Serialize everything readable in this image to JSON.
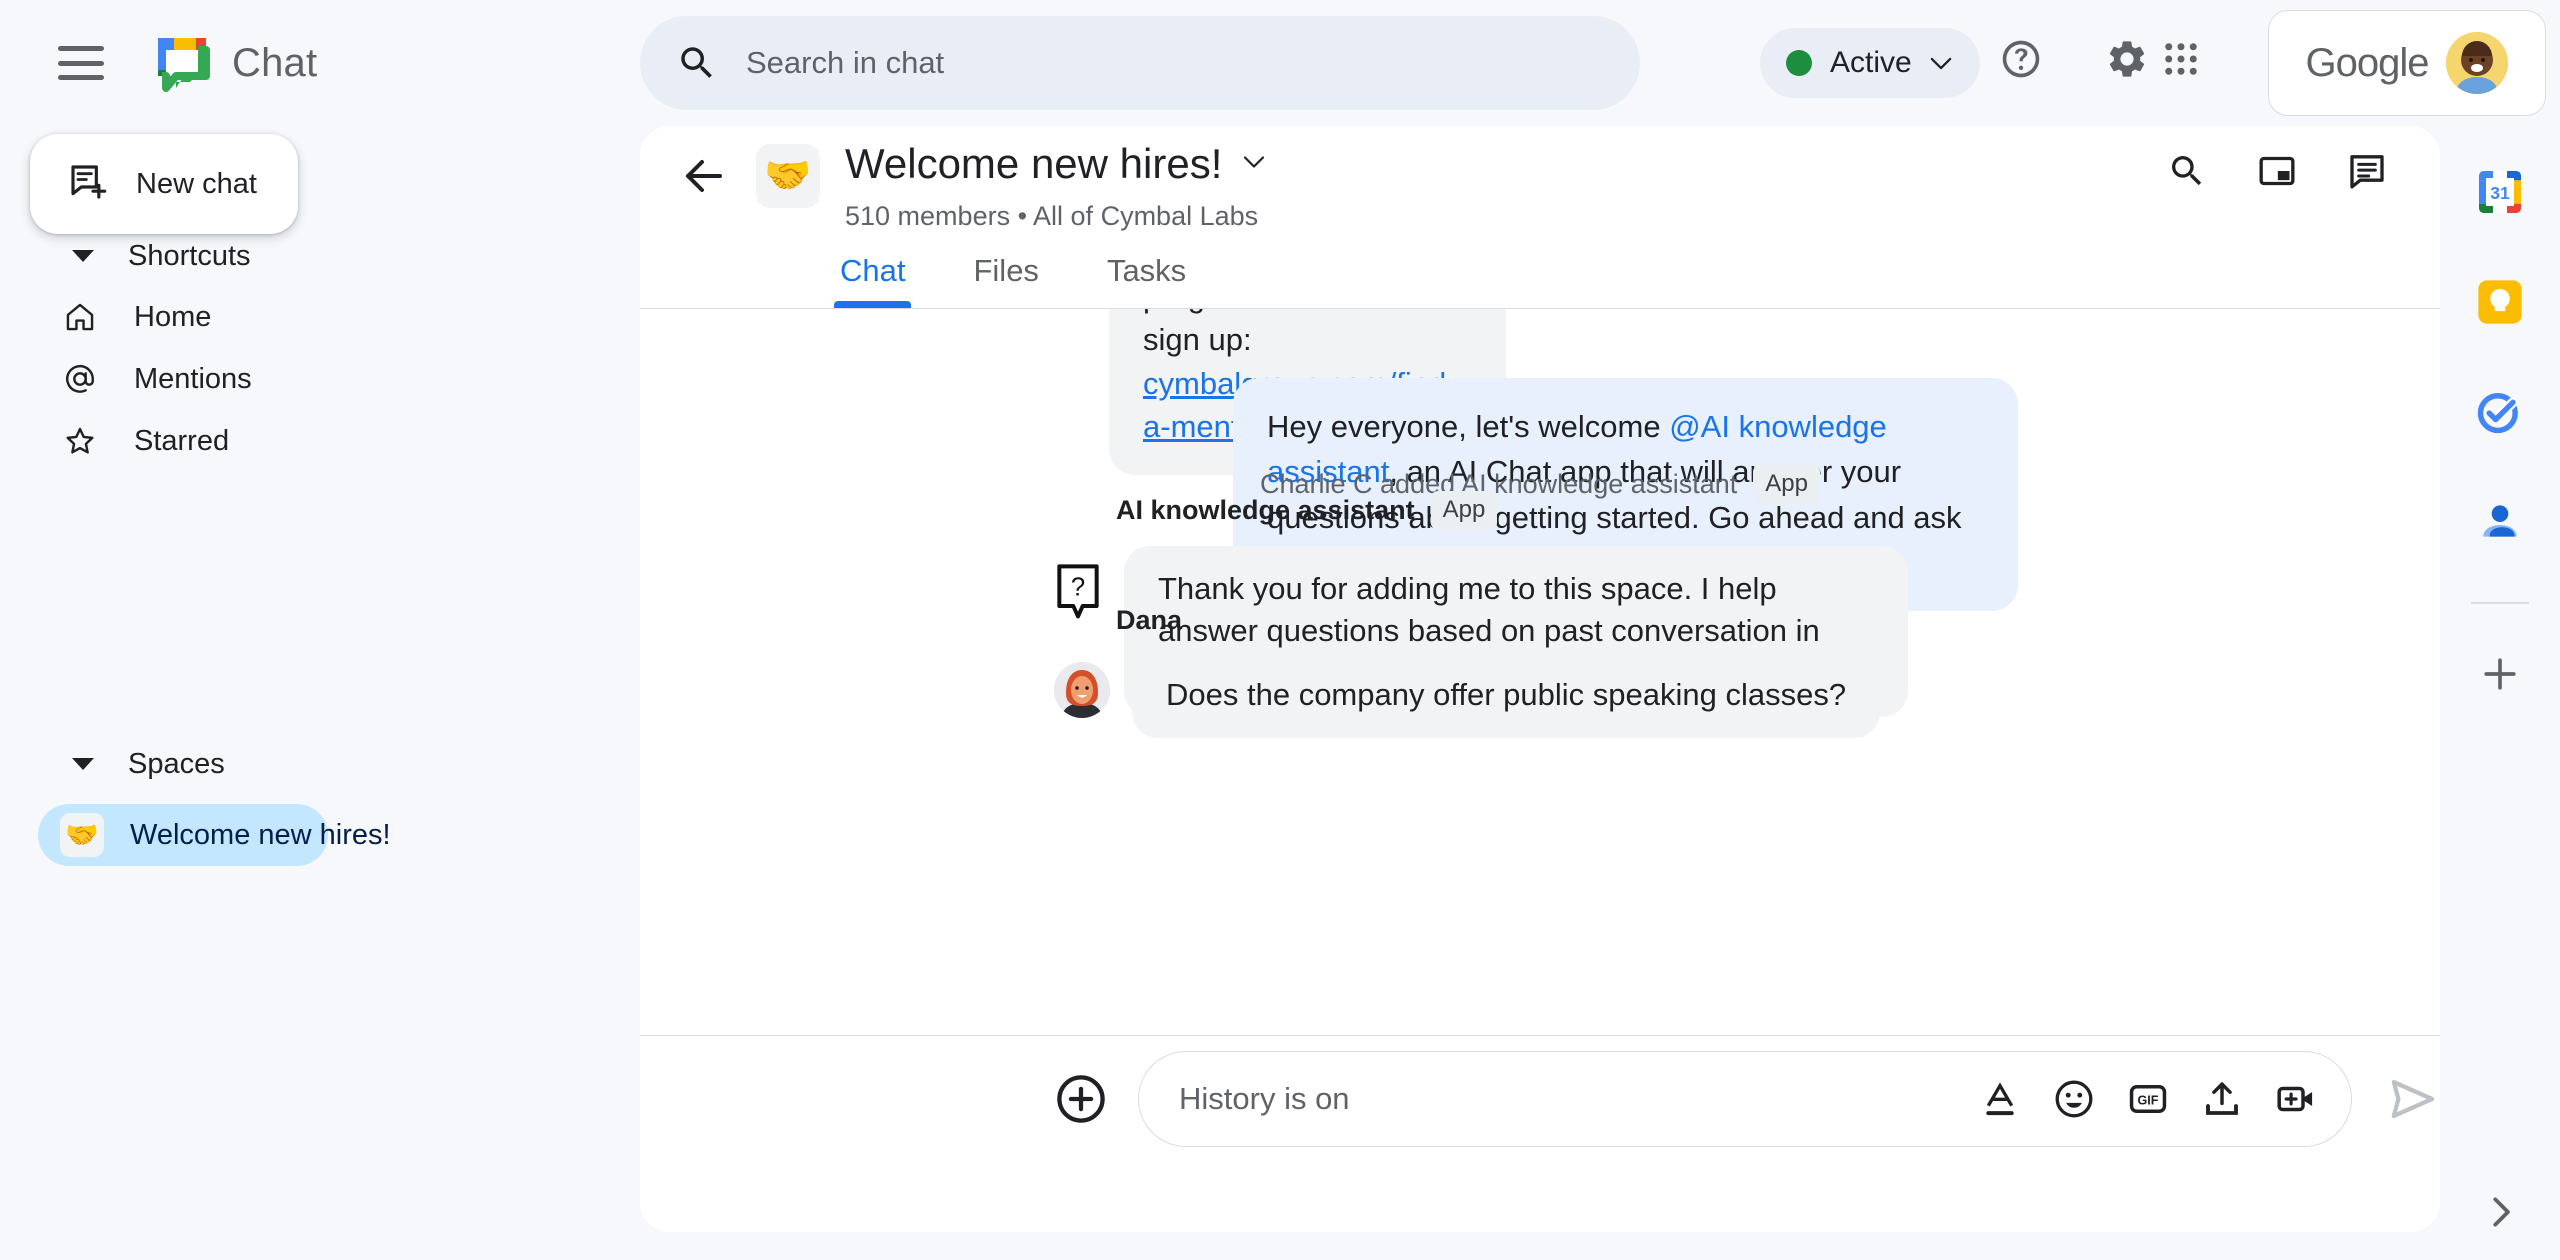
{
  "topbar": {
    "menu_icon": "hamburger-icon",
    "brand": "Chat",
    "brand_logo_icon": "google-chat-logo",
    "search": {
      "placeholder": "Search in chat",
      "icon": "search-icon"
    },
    "status": {
      "label": "Active",
      "color": "#1e8e3e",
      "chevron_icon": "chevron-down-icon"
    },
    "help_icon": "help-icon",
    "settings_icon": "gear-icon",
    "apps_icon": "apps-grid-icon",
    "account": {
      "brand": "Google",
      "avatar_icon": "user-avatar"
    }
  },
  "sidebar": {
    "new_chat": {
      "label": "New chat",
      "icon": "new-chat-icon"
    },
    "shortcuts": {
      "title": "Shortcuts",
      "items": [
        {
          "label": "Home",
          "icon": "home-icon"
        },
        {
          "label": "Mentions",
          "icon": "at-sign-icon"
        },
        {
          "label": "Starred",
          "icon": "star-icon"
        }
      ]
    },
    "spaces": {
      "title": "Spaces",
      "items": [
        {
          "label": "Welcome new hires!",
          "emoji": "🤝",
          "active": true
        }
      ]
    }
  },
  "panel": {
    "back_icon": "back-arrow-icon",
    "space_emoji": "🤝",
    "title": "Welcome new hires!",
    "title_chevron_icon": "chevron-down-icon",
    "subtitle": "510 members  •  All of Cymbal Labs",
    "header_actions": [
      {
        "icon": "search-icon"
      },
      {
        "icon": "picture-in-picture-icon"
      },
      {
        "icon": "chat-pane-icon"
      }
    ],
    "tabs": [
      {
        "label": "Chat",
        "active": true
      },
      {
        "label": "Files",
        "active": false
      },
      {
        "label": "Tasks",
        "active": false
      }
    ]
  },
  "messages": {
    "clipped": {
      "text_line1": "program and how to sign up:",
      "link": "cymbalgroup.com/find-a-mentor"
    },
    "welcome": {
      "prefix": "Hey everyone, let's welcome ",
      "mention": "@AI knowledge assistant",
      "suffix": ", an AI Chat app that will answer your questions about getting started.  Go ahead and ask it a question!"
    },
    "system": {
      "text": "Charlie C added AI knowledge assistant",
      "chip": "App"
    },
    "ai": {
      "sender": "AI knowledge assistant",
      "chip": "App",
      "avatar_icon": "question-mark-app-icon",
      "text": "Thank you for adding me to this space. I help answer questions based on past conversation in this space. Go ahead and ask me a question!"
    },
    "dana": {
      "sender": "Dana",
      "avatar_icon": "dana-avatar",
      "text": "Does the company offer public speaking classes?"
    }
  },
  "composer": {
    "add_icon": "plus-circle-icon",
    "placeholder": "History is on",
    "tools": [
      {
        "icon": "format-text-icon"
      },
      {
        "icon": "emoji-icon"
      },
      {
        "icon": "gif-icon"
      },
      {
        "icon": "upload-icon"
      },
      {
        "icon": "add-video-icon"
      }
    ],
    "send_icon": "send-icon"
  },
  "rail": {
    "items": [
      {
        "icon": "google-calendar-icon",
        "label": "31"
      },
      {
        "icon": "google-keep-icon"
      },
      {
        "icon": "google-tasks-icon"
      },
      {
        "icon": "google-contacts-icon"
      }
    ],
    "add_icon": "plus-icon",
    "expand_icon": "chevron-right-icon"
  }
}
